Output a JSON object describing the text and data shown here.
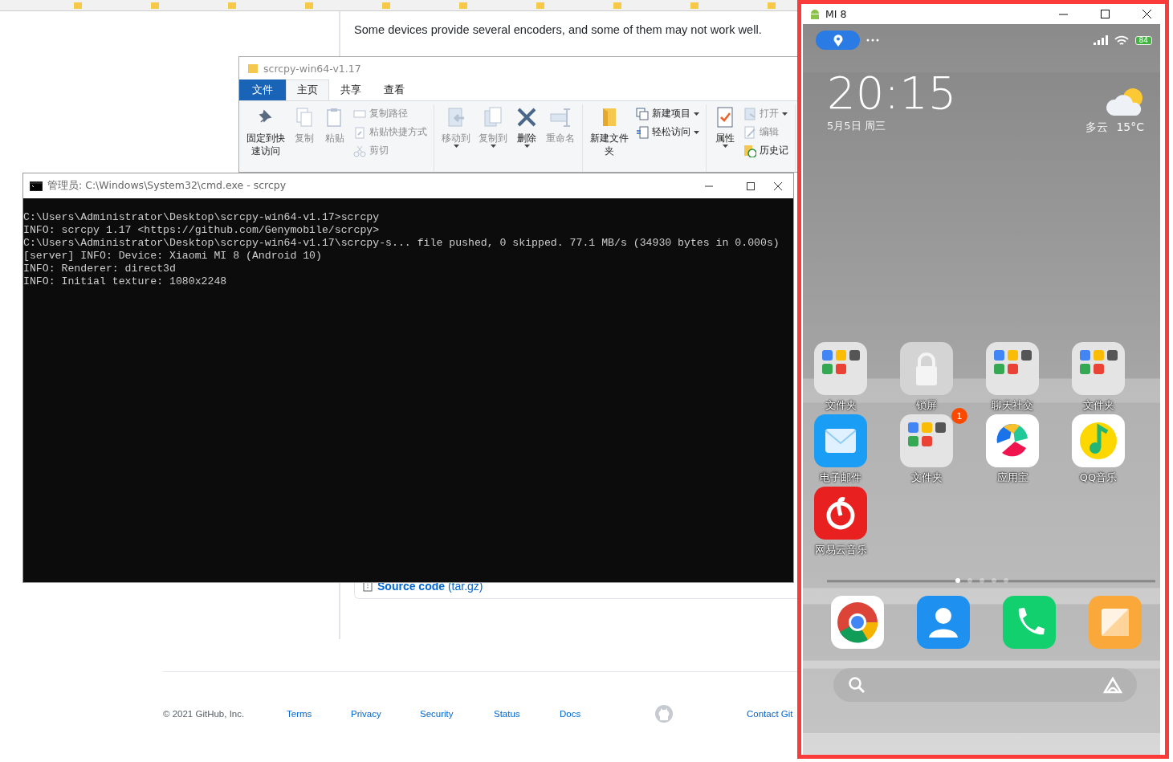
{
  "browser_page": {
    "intro_text": "Some devices provide several encoders, and some of them may not work well.",
    "asset": {
      "name": "Source code",
      "detail": "(tar.gz)"
    },
    "footer": {
      "copyright": "© 2021 GitHub, Inc.",
      "links": [
        "Terms",
        "Privacy",
        "Security",
        "Status",
        "Docs",
        "Contact Git"
      ]
    }
  },
  "explorer": {
    "title": "scrcpy-win64-v1.17",
    "file_tab": "文件",
    "tabs": [
      {
        "label": "主页",
        "selected": true
      },
      {
        "label": "共享",
        "selected": false
      },
      {
        "label": "查看",
        "selected": false
      }
    ],
    "groups": [
      {
        "items": [
          {
            "label": "固定到快速访问",
            "kind": "large",
            "disabled": false,
            "menu": false
          },
          {
            "label": "复制",
            "kind": "large",
            "disabled": true,
            "menu": false
          },
          {
            "label": "粘贴",
            "kind": "large",
            "disabled": true,
            "menu": false
          },
          {
            "label": "复制路径",
            "kind": "small",
            "disabled": true,
            "menu": false
          },
          {
            "label": "粘贴快捷方式",
            "kind": "small",
            "disabled": true,
            "menu": false
          },
          {
            "label": "剪切",
            "kind": "small",
            "disabled": true,
            "menu": false
          }
        ]
      },
      {
        "items": [
          {
            "label": "移动到",
            "kind": "large",
            "disabled": true,
            "menu": true
          },
          {
            "label": "复制到",
            "kind": "large",
            "disabled": true,
            "menu": true
          },
          {
            "label": "删除",
            "kind": "large",
            "disabled": false,
            "menu": true
          },
          {
            "label": "重命名",
            "kind": "large",
            "disabled": true,
            "menu": false
          }
        ]
      },
      {
        "items": [
          {
            "label": "新建文件夹",
            "kind": "large",
            "disabled": false,
            "menu": false
          },
          {
            "label": "新建项目",
            "kind": "small",
            "disabled": false,
            "menu": true
          },
          {
            "label": "轻松访问",
            "kind": "small",
            "disabled": false,
            "menu": true
          }
        ]
      },
      {
        "items": [
          {
            "label": "属性",
            "kind": "large",
            "disabled": false,
            "menu": true
          },
          {
            "label": "打开",
            "kind": "small",
            "disabled": true,
            "menu": true
          },
          {
            "label": "编辑",
            "kind": "small",
            "disabled": true,
            "menu": false
          },
          {
            "label": "历史记",
            "kind": "small",
            "disabled": false,
            "menu": false
          }
        ]
      }
    ]
  },
  "console": {
    "title": "管理员: C:\\Windows\\System32\\cmd.exe - scrcpy",
    "lines": [
      "C:\\Users\\Administrator\\Desktop\\scrcpy-win64-v1.17>scrcpy",
      "INFO: scrcpy 1.17 <https://github.com/Genymobile/scrcpy>",
      "C:\\Users\\Administrator\\Desktop\\scrcpy-win64-v1.17\\scrcpy-s... file pushed, 0 skipped. 77.1 MB/s (34930 bytes in 0.000s)",
      "[server] INFO: Device: Xiaomi MI 8 (Android 10)",
      "INFO: Renderer: direct3d",
      "INFO: Initial texture: 1080x2248"
    ]
  },
  "phone": {
    "title": "MI 8",
    "battery": "84",
    "clock": "20:15",
    "date": "5月5日 周三",
    "weather": "多云",
    "temperature": "15°C",
    "apps": [
      {
        "label": "文件夹",
        "kind": "folder"
      },
      {
        "label": "锁屏",
        "kind": "lock"
      },
      {
        "label": "聊天社交",
        "kind": "folder"
      },
      {
        "label": "文件夹",
        "kind": "folder"
      },
      {
        "label": "电子邮件",
        "kind": "mail"
      },
      {
        "label": "文件夹",
        "kind": "folder",
        "badge": "1"
      },
      {
        "label": "应用宝",
        "kind": "store"
      },
      {
        "label": "QQ音乐",
        "kind": "music"
      },
      {
        "label": "网易云音乐",
        "kind": "cloudmusic"
      }
    ],
    "page_dots": [
      {
        "selected": true
      },
      {
        "selected": false
      },
      {
        "selected": false
      },
      {
        "selected": false
      },
      {
        "selected": false
      }
    ],
    "dock": [
      {
        "kind": "browser"
      },
      {
        "kind": "contacts"
      },
      {
        "kind": "phone"
      },
      {
        "kind": "notes"
      }
    ]
  }
}
